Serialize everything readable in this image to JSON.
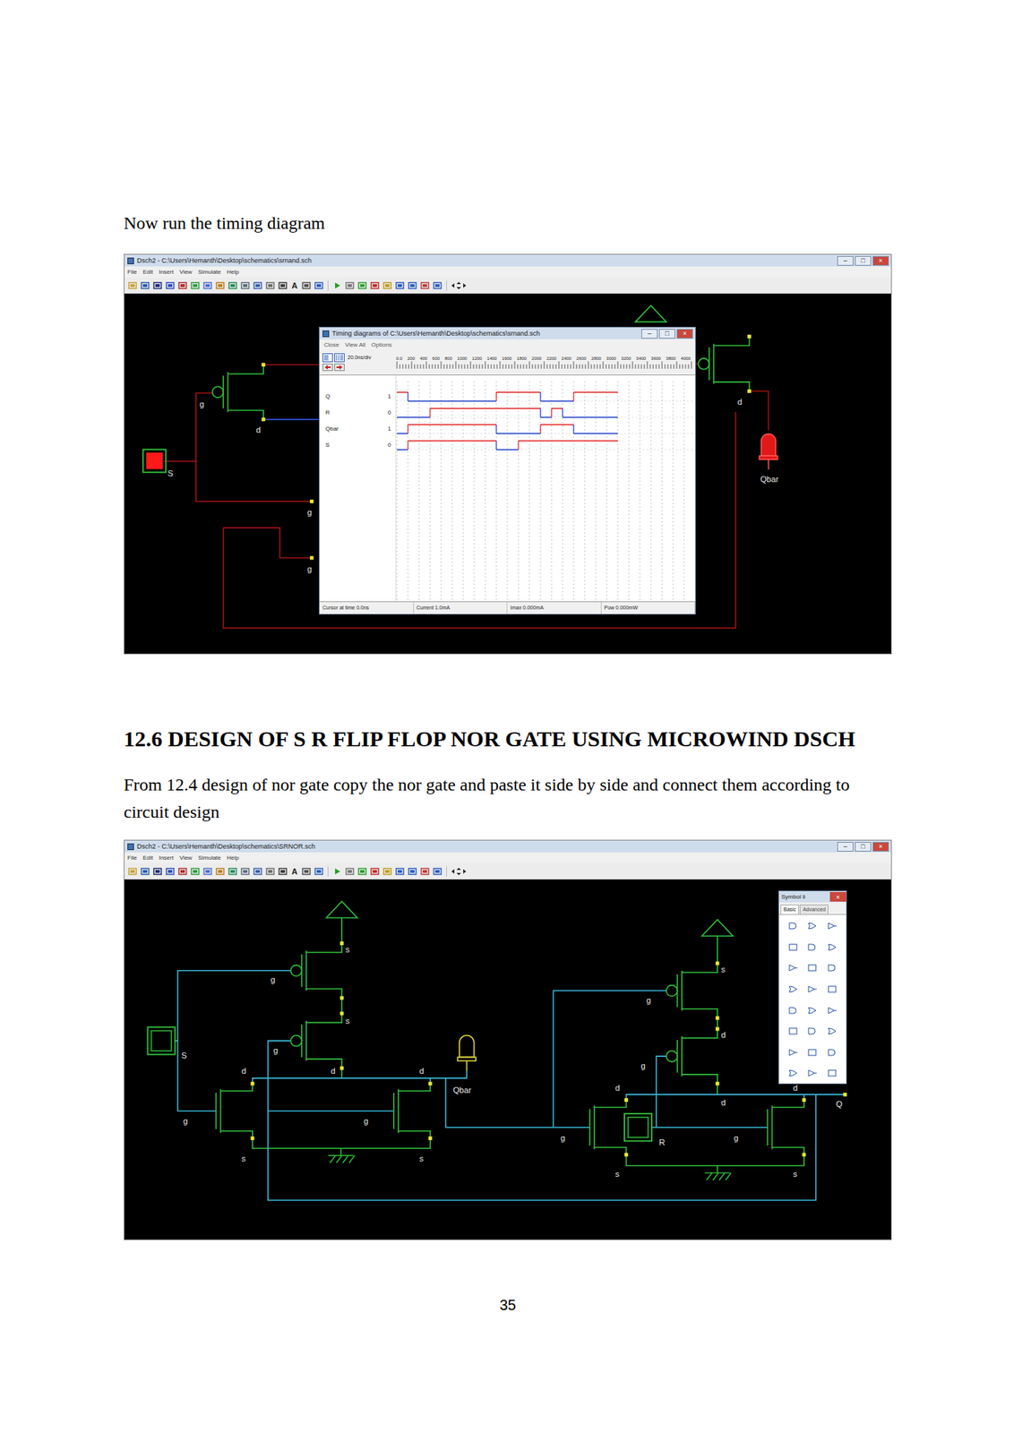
{
  "page": {
    "intro": "Now run the timing diagram",
    "heading": "12.6 DESIGN OF S R FLIP FLOP NOR GATE USING MICROWIND DSCH",
    "paragraph": "From 12.4 design of nor gate copy the nor gate and paste it side by side and connect them according to circuit design",
    "page_number": "35"
  },
  "schematic_1": {
    "title": "Dsch2 - C:\\Users\\Hemanth\\Desktop\\schematics\\srnand.sch",
    "controls": [
      "–",
      "□",
      "×"
    ],
    "menu": [
      "File",
      "Edit",
      "Insert",
      "View",
      "Simulate",
      "Help"
    ],
    "toolbar_glyph": "A",
    "labels": [
      "g",
      "d",
      "S",
      "g",
      "g",
      "d",
      "Qbar"
    ],
    "input_s_on": true,
    "led_qbar_on": true,
    "timing": {
      "title": "Timing diagrams of C:\\Users\\Hemanth\\Desktop\\schematics\\srnand.sch",
      "controls": [
        "–",
        "□",
        "×"
      ],
      "menu": [
        "Close",
        "View All",
        "Options"
      ],
      "scale": "20.0ns/div",
      "ticks": [
        "0.0",
        "200",
        "400",
        "600",
        "800",
        "1000",
        "1200",
        "1400",
        "1600",
        "1800",
        "2000",
        "2200",
        "2400",
        "2600",
        "2800",
        "3000",
        "3200",
        "3400",
        "3600",
        "3800",
        "4000"
      ],
      "signals": [
        {
          "name": "Q",
          "value": "1",
          "levels": [
            1,
            0,
            0,
            0,
            0,
            0,
            0,
            0,
            0,
            1,
            1,
            1,
            1,
            0,
            0,
            0,
            1,
            1,
            1,
            1
          ]
        },
        {
          "name": "R",
          "value": "0",
          "levels": [
            0,
            0,
            0,
            1,
            1,
            1,
            1,
            1,
            1,
            1,
            1,
            1,
            1,
            0,
            1,
            0,
            0,
            0,
            0,
            0
          ]
        },
        {
          "name": "Qbar",
          "value": "1",
          "levels": [
            0,
            1,
            1,
            1,
            1,
            1,
            1,
            1,
            1,
            0,
            0,
            0,
            0,
            1,
            1,
            1,
            0,
            0,
            0,
            0
          ]
        },
        {
          "name": "S",
          "value": "0",
          "levels": [
            0,
            1,
            1,
            1,
            1,
            1,
            1,
            1,
            1,
            0,
            0,
            1,
            1,
            1,
            1,
            1,
            1,
            1,
            1,
            1
          ]
        }
      ],
      "status": [
        "Cursor at time 0.0ns",
        "Current 1.0mA",
        "Imax 0.000mA",
        "Pow 0.000mW"
      ]
    }
  },
  "schematic_2": {
    "title": "Dsch2 - C:\\Users\\Hemanth\\Desktop\\schematics\\SRNOR.sch",
    "controls": [
      "–",
      "□",
      "×"
    ],
    "menu": [
      "File",
      "Edit",
      "Insert",
      "View",
      "Simulate",
      "Help"
    ],
    "toolbar_glyph": "A",
    "labels": [
      "s",
      "g",
      "s",
      "g",
      "S",
      "d",
      "d",
      "d",
      "Qbar",
      "g",
      "g",
      "s",
      "s",
      "s",
      "g",
      "d",
      "g",
      "d",
      "d",
      "d",
      "Q",
      "g",
      "R",
      "g",
      "s",
      "s"
    ],
    "input_s_on": false,
    "input_r_on": false,
    "led_qbar_on": false,
    "symbol_panel": {
      "title": "Symbol li",
      "close": "×",
      "tabs": [
        {
          "label": "Basic",
          "selected": true
        },
        {
          "label": "Advanced",
          "selected": false
        }
      ]
    }
  }
}
